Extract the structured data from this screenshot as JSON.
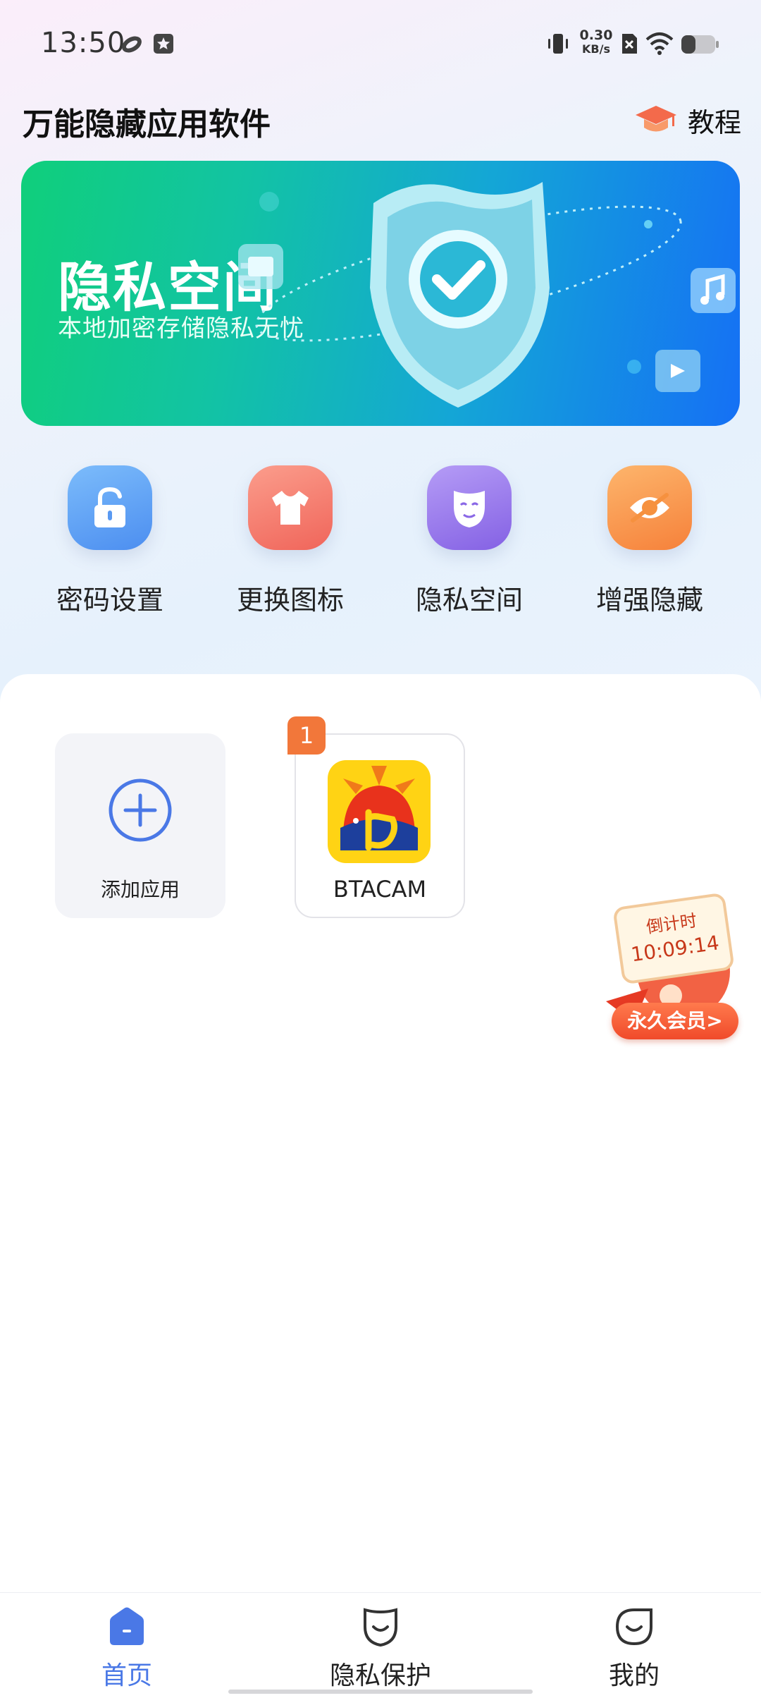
{
  "status_bar": {
    "time": "13:50",
    "net_speed_value": "0.30",
    "net_speed_unit": "KB/s",
    "icons": [
      "cloud-sync-icon",
      "notification-star-icon",
      "vibrate-icon",
      "sim-no-signal-icon",
      "wifi-icon",
      "battery-icon"
    ]
  },
  "header": {
    "title": "万能隐藏应用软件",
    "tutorial_label": "教程",
    "tutorial_icon": "graduation-cap-icon"
  },
  "banner": {
    "title": "隐私空间",
    "subtitle": "本地加密存储隐私无忧"
  },
  "features": [
    {
      "label": "密码设置",
      "icon": "unlock-icon",
      "color": "#5aa0f5"
    },
    {
      "label": "更换图标",
      "icon": "tshirt-icon",
      "color": "#f5766a"
    },
    {
      "label": "隐私空间",
      "icon": "mask-icon",
      "color": "#9a72ea"
    },
    {
      "label": "增强隐藏",
      "icon": "eye-hidden-icon",
      "color": "#f98d3c"
    }
  ],
  "apps": {
    "add_label": "添加应用",
    "items": [
      {
        "name": "BTACAM",
        "badge": "1"
      }
    ]
  },
  "promo": {
    "label": "倒计时",
    "countdown": "10:09:14",
    "button": "永久会员>"
  },
  "bottom_nav": {
    "items": [
      {
        "label": "首页",
        "active": true
      },
      {
        "label": "隐私保护",
        "active": false
      },
      {
        "label": "我的",
        "active": false
      }
    ]
  },
  "colors": {
    "accent": "#4a78e6",
    "badge": "#f2773a",
    "banner_start": "#10cf7b",
    "banner_end": "#1570f5"
  }
}
